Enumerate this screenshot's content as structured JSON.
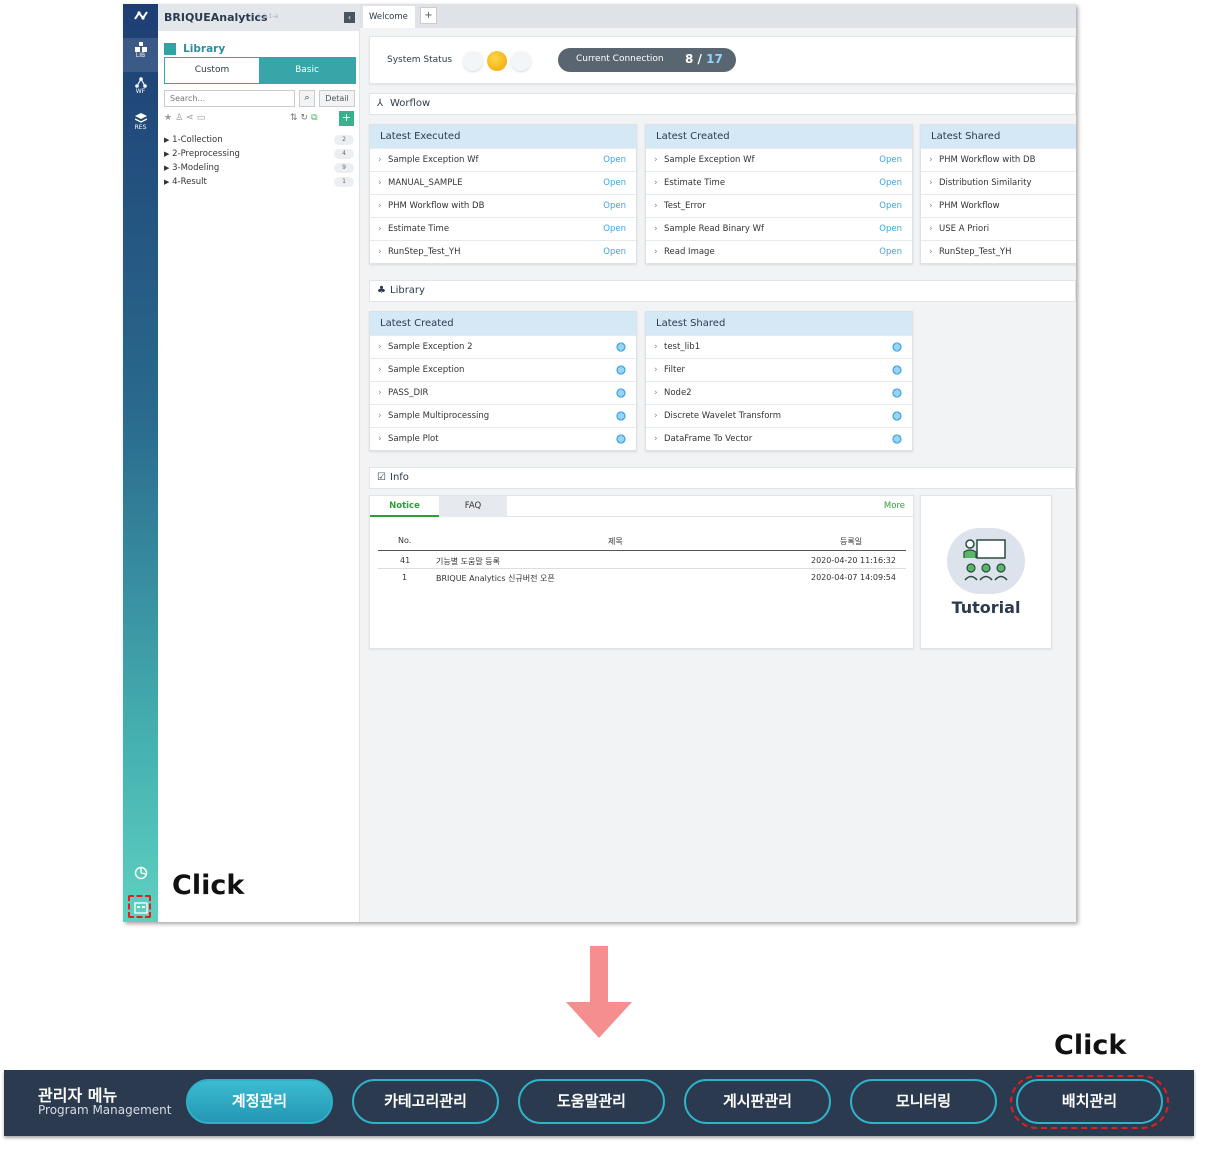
{
  "app": {
    "brand": "BRIQUEAnalytics",
    "version": "1.2.1-a"
  },
  "rail": {
    "lib": "LIB",
    "wf": "WF",
    "res": "RES"
  },
  "library": {
    "title": "Library",
    "tab_custom": "Custom",
    "tab_basic": "Basic",
    "search_placeholder": "Search...",
    "detail": "Detail",
    "tree": [
      {
        "label": "1-Collection",
        "count": "2"
      },
      {
        "label": "2-Preprocessing",
        "count": "4"
      },
      {
        "label": "3-Modeling",
        "count": "9"
      },
      {
        "label": "4-Result",
        "count": "1"
      }
    ]
  },
  "tabs": {
    "welcome": "Welcome",
    "add": "+"
  },
  "status": {
    "label": "System Status",
    "conn_label": "Current Connection",
    "conn_value": "8",
    "conn_sep": "/",
    "conn_total": "17"
  },
  "workflow": {
    "title": "Worflow",
    "executed": {
      "title": "Latest Executed",
      "items": [
        "Sample Exception Wf",
        "MANUAL_SAMPLE",
        "PHM Workflow with DB",
        "Estimate Time",
        "RunStep_Test_YH"
      ]
    },
    "created": {
      "title": "Latest Created",
      "items": [
        "Sample Exception Wf",
        "Estimate Time",
        "Test_Error",
        "Sample Read Binary Wf",
        "Read Image"
      ]
    },
    "shared": {
      "title": "Latest Shared",
      "items": [
        "PHM Workflow with DB",
        "Distribution Similarity",
        "PHM Workflow",
        "USE A Priori",
        "RunStep_Test_YH"
      ]
    },
    "open_label": "Open"
  },
  "lib_section": {
    "title": "Library",
    "created": {
      "title": "Latest Created",
      "items": [
        "Sample Exception 2",
        "Sample Exception",
        "PASS_DIR",
        "Sample Multiprocessing",
        "Sample Plot"
      ]
    },
    "shared": {
      "title": "Latest Shared",
      "items": [
        "test_lib1",
        "Filter",
        "Node2",
        "Discrete Wavelet Transform",
        "DataFrame To Vector"
      ]
    }
  },
  "info": {
    "title": "Info",
    "tab_notice": "Notice",
    "tab_faq": "FAQ",
    "more": "More",
    "cols": {
      "no": "No.",
      "title": "제목",
      "date": "등록일"
    },
    "rows": [
      {
        "no": "41",
        "title": "기능별 도움말 등록",
        "date": "2020-04-20 11:16:32"
      },
      {
        "no": "1",
        "title": "BRIQUE Analytics 신규버전 오픈",
        "date": "2020-04-07 14:09:54"
      }
    ],
    "tutorial": "Tutorial"
  },
  "callouts": {
    "click1": "Click",
    "click2": "Click"
  },
  "admin": {
    "title": "관리자 메뉴",
    "subtitle": "Program Management",
    "buttons": [
      "계정관리",
      "카테고리관리",
      "도움말관리",
      "게시판관리",
      "모니터링",
      "배치관리"
    ]
  },
  "colors": {
    "accent": "#2fb3c9",
    "highlight": "#e0201c",
    "arrow": "#f48e8f",
    "open": "#3aa4e6"
  }
}
